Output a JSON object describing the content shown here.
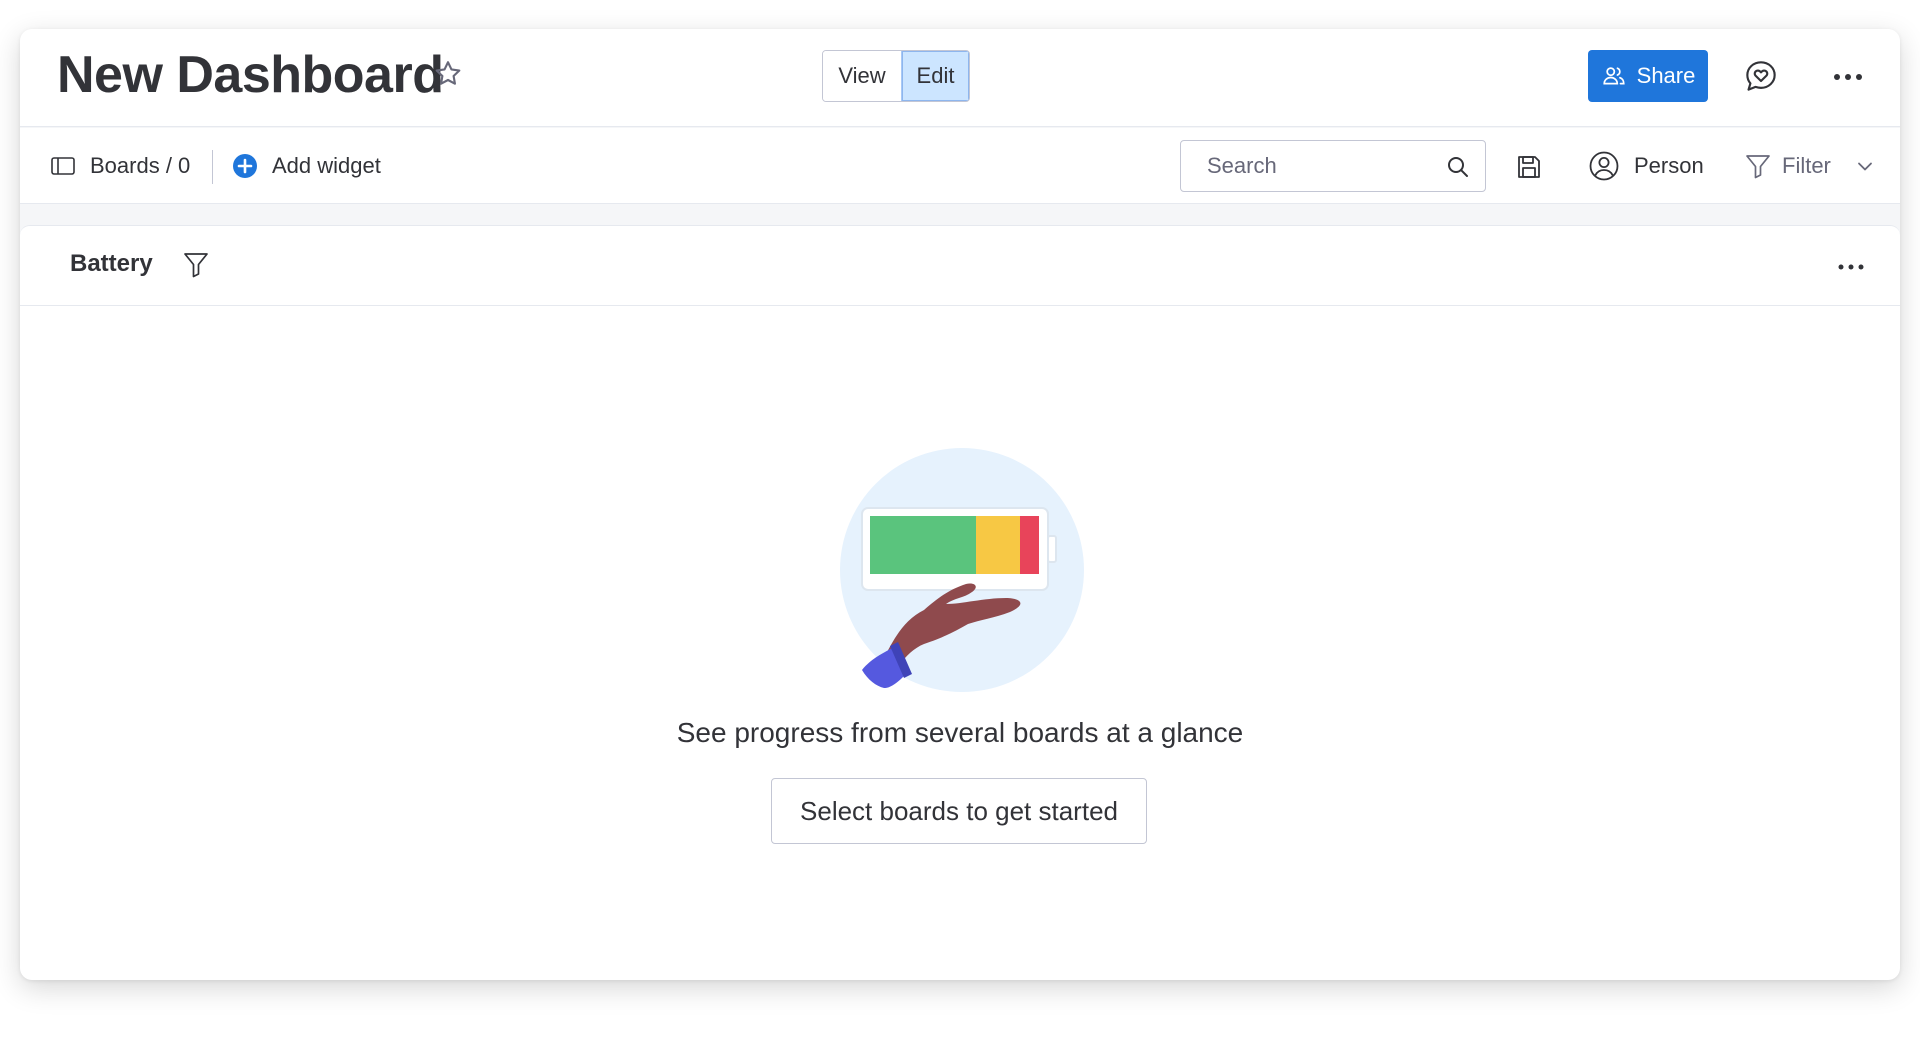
{
  "header": {
    "title": "New Dashboard",
    "view_label": "View",
    "edit_label": "Edit",
    "active_mode": "Edit",
    "share_label": "Share",
    "icons": [
      "star-icon",
      "people-icon",
      "update-heart-icon",
      "more-horizontal-icon"
    ]
  },
  "toolbar": {
    "boards_label": "Boards / 0",
    "add_widget_label": "Add widget",
    "search_placeholder": "Search",
    "search_value": "",
    "person_label": "Person",
    "filter_label": "Filter",
    "icons": [
      "board-panel-icon",
      "add-circle-icon",
      "search-icon",
      "save-icon",
      "person-circle-icon",
      "funnel-icon",
      "chevron-down-icon"
    ]
  },
  "widget": {
    "title": "Battery",
    "empty_message": "See progress from several boards at a glance",
    "cta_label": "Select boards to get started",
    "icons": [
      "funnel-icon",
      "more-horizontal-icon"
    ]
  },
  "colors": {
    "primary": "#1f76db",
    "edit_selected_bg": "#cce5ff",
    "battery_green": "#5ac47d",
    "battery_yellow": "#f7c844",
    "battery_red": "#e8445a",
    "illustration_bg": "#e6f2fd"
  }
}
